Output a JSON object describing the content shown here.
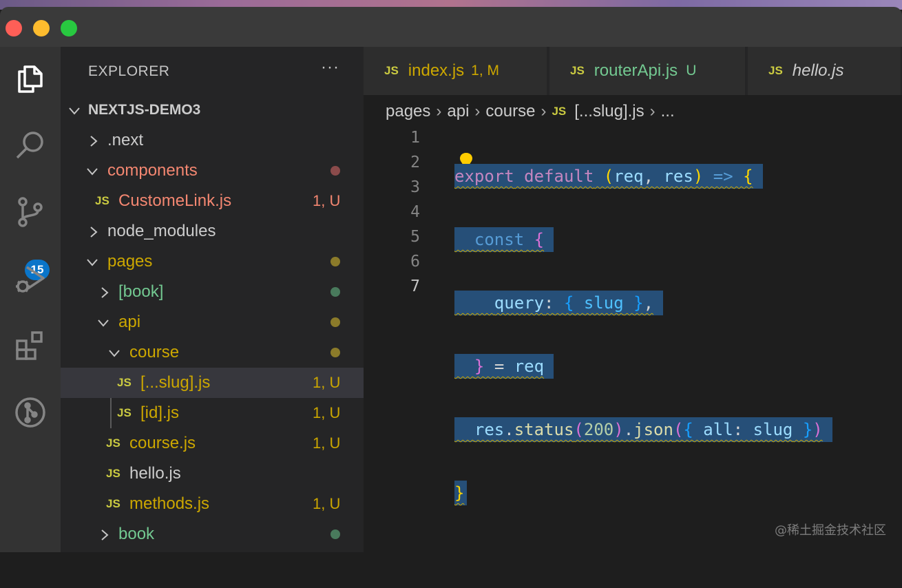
{
  "window": {
    "colors": {
      "close": "#fe5f57",
      "minimize": "#febc2e",
      "zoom": "#28c840"
    }
  },
  "activity_bar": {
    "items": [
      "explorer-icon",
      "search-icon",
      "source-control-icon",
      "run-debug-icon",
      "extensions-icon",
      "git-graph-icon"
    ],
    "source_control_badge": "15"
  },
  "explorer": {
    "title": "EXPLORER",
    "more": "···",
    "project": "NEXTJS-DEMO3",
    "tree": [
      {
        "label": ".next",
        "type": "folder",
        "expanded": false,
        "status": "",
        "color": "#cccccc"
      },
      {
        "label": "components",
        "type": "folder",
        "expanded": true,
        "status": "",
        "dot": "#8b4b4b",
        "color": "#f48771"
      },
      {
        "label": "CustomeLink.js",
        "type": "file",
        "status": "1, U",
        "color": "#f48771"
      },
      {
        "label": "node_modules",
        "type": "folder",
        "expanded": false,
        "status": "",
        "color": "#cccccc"
      },
      {
        "label": "pages",
        "type": "folder",
        "expanded": true,
        "status": "",
        "dot": "#8b7b2a",
        "color": "#cca700"
      },
      {
        "label": "[book]",
        "type": "folder",
        "expanded": false,
        "status": "",
        "dot": "#497a5c",
        "color": "#73c991"
      },
      {
        "label": "api",
        "type": "folder",
        "expanded": true,
        "status": "",
        "dot": "#8b7b2a",
        "color": "#cca700"
      },
      {
        "label": "course",
        "type": "folder",
        "expanded": true,
        "status": "",
        "dot": "#8b7b2a",
        "color": "#cca700"
      },
      {
        "label": "[...slug].js",
        "type": "file",
        "status": "1, U",
        "color": "#cca700",
        "selected": true
      },
      {
        "label": "[id].js",
        "type": "file",
        "status": "1, U",
        "color": "#cca700"
      },
      {
        "label": "course.js",
        "type": "file",
        "status": "1, U",
        "color": "#cca700"
      },
      {
        "label": "hello.js",
        "type": "file",
        "status": "",
        "color": "#cccccc"
      },
      {
        "label": "methods.js",
        "type": "file",
        "status": "1, U",
        "color": "#cca700"
      },
      {
        "label": "book",
        "type": "folder",
        "expanded": false,
        "status": "",
        "dot": "#497a5c",
        "color": "#73c991"
      }
    ]
  },
  "tabs": [
    {
      "icon": "JS",
      "label": "index.js",
      "status": "1, M",
      "color": "#cca700"
    },
    {
      "icon": "JS",
      "label": "routerApi.js",
      "status": "U",
      "color": "#73c991"
    },
    {
      "icon": "JS",
      "label": "hello.js",
      "status": "",
      "color": "#cccccc",
      "italic": true
    }
  ],
  "breadcrumb": {
    "items": [
      "pages",
      "api",
      "course"
    ],
    "file_icon": "JS",
    "file": "[...slug].js",
    "more": "..."
  },
  "editor": {
    "line_numbers": [
      "1",
      "2",
      "3",
      "4",
      "5",
      "6",
      "7"
    ],
    "lines": [
      "export default (req, res) => {",
      "  const {",
      "    query: { slug },",
      "  } = req",
      "  res.status(200).json({ all: slug })",
      "}",
      ""
    ]
  },
  "watermark": "@稀土掘金技术社区"
}
